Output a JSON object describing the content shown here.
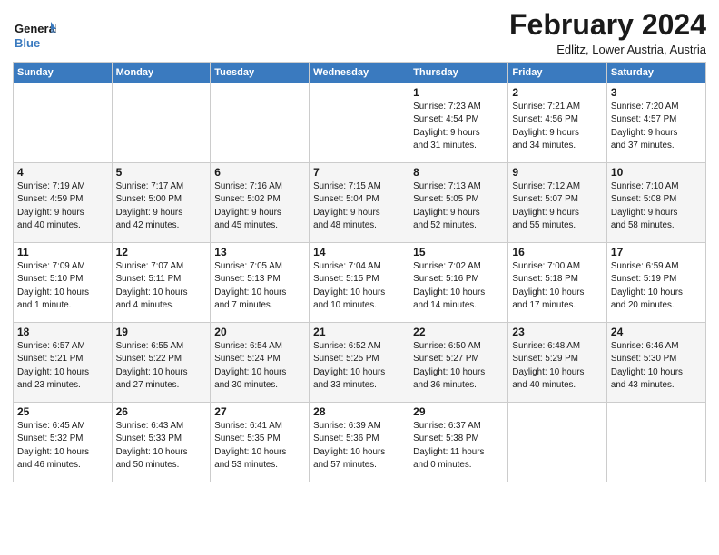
{
  "logo": {
    "line1": "General",
    "line2": "Blue"
  },
  "title": "February 2024",
  "subtitle": "Edlitz, Lower Austria, Austria",
  "days_of_week": [
    "Sunday",
    "Monday",
    "Tuesday",
    "Wednesday",
    "Thursday",
    "Friday",
    "Saturday"
  ],
  "weeks": [
    [
      {
        "day": "",
        "info": ""
      },
      {
        "day": "",
        "info": ""
      },
      {
        "day": "",
        "info": ""
      },
      {
        "day": "",
        "info": ""
      },
      {
        "day": "1",
        "info": "Sunrise: 7:23 AM\nSunset: 4:54 PM\nDaylight: 9 hours\nand 31 minutes."
      },
      {
        "day": "2",
        "info": "Sunrise: 7:21 AM\nSunset: 4:56 PM\nDaylight: 9 hours\nand 34 minutes."
      },
      {
        "day": "3",
        "info": "Sunrise: 7:20 AM\nSunset: 4:57 PM\nDaylight: 9 hours\nand 37 minutes."
      }
    ],
    [
      {
        "day": "4",
        "info": "Sunrise: 7:19 AM\nSunset: 4:59 PM\nDaylight: 9 hours\nand 40 minutes."
      },
      {
        "day": "5",
        "info": "Sunrise: 7:17 AM\nSunset: 5:00 PM\nDaylight: 9 hours\nand 42 minutes."
      },
      {
        "day": "6",
        "info": "Sunrise: 7:16 AM\nSunset: 5:02 PM\nDaylight: 9 hours\nand 45 minutes."
      },
      {
        "day": "7",
        "info": "Sunrise: 7:15 AM\nSunset: 5:04 PM\nDaylight: 9 hours\nand 48 minutes."
      },
      {
        "day": "8",
        "info": "Sunrise: 7:13 AM\nSunset: 5:05 PM\nDaylight: 9 hours\nand 52 minutes."
      },
      {
        "day": "9",
        "info": "Sunrise: 7:12 AM\nSunset: 5:07 PM\nDaylight: 9 hours\nand 55 minutes."
      },
      {
        "day": "10",
        "info": "Sunrise: 7:10 AM\nSunset: 5:08 PM\nDaylight: 9 hours\nand 58 minutes."
      }
    ],
    [
      {
        "day": "11",
        "info": "Sunrise: 7:09 AM\nSunset: 5:10 PM\nDaylight: 10 hours\nand 1 minute."
      },
      {
        "day": "12",
        "info": "Sunrise: 7:07 AM\nSunset: 5:11 PM\nDaylight: 10 hours\nand 4 minutes."
      },
      {
        "day": "13",
        "info": "Sunrise: 7:05 AM\nSunset: 5:13 PM\nDaylight: 10 hours\nand 7 minutes."
      },
      {
        "day": "14",
        "info": "Sunrise: 7:04 AM\nSunset: 5:15 PM\nDaylight: 10 hours\nand 10 minutes."
      },
      {
        "day": "15",
        "info": "Sunrise: 7:02 AM\nSunset: 5:16 PM\nDaylight: 10 hours\nand 14 minutes."
      },
      {
        "day": "16",
        "info": "Sunrise: 7:00 AM\nSunset: 5:18 PM\nDaylight: 10 hours\nand 17 minutes."
      },
      {
        "day": "17",
        "info": "Sunrise: 6:59 AM\nSunset: 5:19 PM\nDaylight: 10 hours\nand 20 minutes."
      }
    ],
    [
      {
        "day": "18",
        "info": "Sunrise: 6:57 AM\nSunset: 5:21 PM\nDaylight: 10 hours\nand 23 minutes."
      },
      {
        "day": "19",
        "info": "Sunrise: 6:55 AM\nSunset: 5:22 PM\nDaylight: 10 hours\nand 27 minutes."
      },
      {
        "day": "20",
        "info": "Sunrise: 6:54 AM\nSunset: 5:24 PM\nDaylight: 10 hours\nand 30 minutes."
      },
      {
        "day": "21",
        "info": "Sunrise: 6:52 AM\nSunset: 5:25 PM\nDaylight: 10 hours\nand 33 minutes."
      },
      {
        "day": "22",
        "info": "Sunrise: 6:50 AM\nSunset: 5:27 PM\nDaylight: 10 hours\nand 36 minutes."
      },
      {
        "day": "23",
        "info": "Sunrise: 6:48 AM\nSunset: 5:29 PM\nDaylight: 10 hours\nand 40 minutes."
      },
      {
        "day": "24",
        "info": "Sunrise: 6:46 AM\nSunset: 5:30 PM\nDaylight: 10 hours\nand 43 minutes."
      }
    ],
    [
      {
        "day": "25",
        "info": "Sunrise: 6:45 AM\nSunset: 5:32 PM\nDaylight: 10 hours\nand 46 minutes."
      },
      {
        "day": "26",
        "info": "Sunrise: 6:43 AM\nSunset: 5:33 PM\nDaylight: 10 hours\nand 50 minutes."
      },
      {
        "day": "27",
        "info": "Sunrise: 6:41 AM\nSunset: 5:35 PM\nDaylight: 10 hours\nand 53 minutes."
      },
      {
        "day": "28",
        "info": "Sunrise: 6:39 AM\nSunset: 5:36 PM\nDaylight: 10 hours\nand 57 minutes."
      },
      {
        "day": "29",
        "info": "Sunrise: 6:37 AM\nSunset: 5:38 PM\nDaylight: 11 hours\nand 0 minutes."
      },
      {
        "day": "",
        "info": ""
      },
      {
        "day": "",
        "info": ""
      }
    ]
  ]
}
